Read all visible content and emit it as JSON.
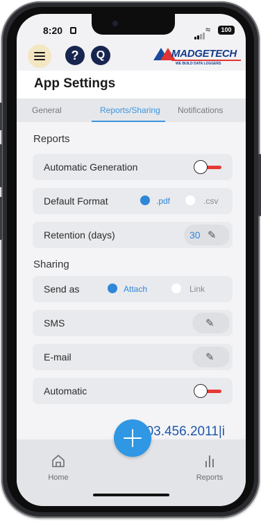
{
  "status_bar": {
    "time": "8:20",
    "battery": "100"
  },
  "header": {
    "help_icon": "?",
    "q_icon": "Q",
    "logo_name": "MADGETECH",
    "logo_tagline": "WE BUILD DATA LOGGERS"
  },
  "page": {
    "title": "App Settings"
  },
  "tabs": [
    {
      "label": "General"
    },
    {
      "label": "Reports/Sharing",
      "active": true
    },
    {
      "label": "Notifications"
    }
  ],
  "reports": {
    "section_title": "Reports",
    "automatic_generation": {
      "label": "Automatic Generation"
    },
    "default_format": {
      "label": "Default Format",
      "options": [
        ".pdf",
        ".csv"
      ],
      "selected": ".pdf"
    },
    "retention": {
      "label": "Retention (days)",
      "value": "30"
    }
  },
  "sharing": {
    "section_title": "Sharing",
    "send_as": {
      "label": "Send as",
      "options": [
        "Attach",
        "Link"
      ],
      "selected": "Attach"
    },
    "sms": {
      "label": "SMS"
    },
    "email": {
      "label": "E-mail"
    },
    "automatic": {
      "label": "Automatic"
    }
  },
  "overlay_text": "603.456.2011|i",
  "bottom_nav": {
    "home_label": "Home",
    "reports_label": "Reports"
  },
  "colors": {
    "accent": "#2f87d8",
    "toggle_off": "#e53935",
    "brand_navy": "#17254f"
  }
}
